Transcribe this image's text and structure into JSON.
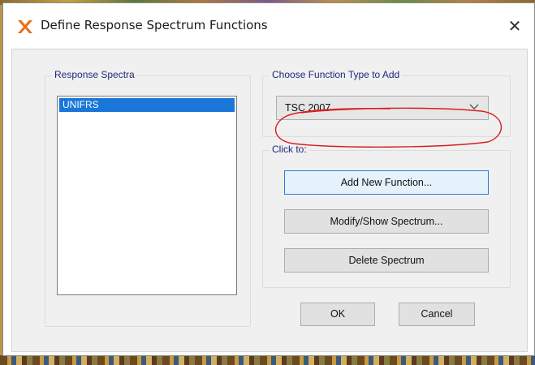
{
  "window": {
    "title": "Define Response Spectrum Functions",
    "icon": "app-logo-icon",
    "close_label": "✕"
  },
  "spectra": {
    "legend": "Response Spectra",
    "items": [
      "UNIFRS"
    ],
    "selected_index": 0
  },
  "function_type": {
    "legend": "Choose  Function Type to Add",
    "selected": "TSC 2007"
  },
  "actions": {
    "legend": "Click to:",
    "add_label": "Add New Function...",
    "modify_label": "Modify/Show Spectrum...",
    "delete_label": "Delete Spectrum"
  },
  "footer": {
    "ok_label": "OK",
    "cancel_label": "Cancel"
  },
  "colors": {
    "selection": "#1a76d8",
    "group_label": "#1e2a7a",
    "annotation": "#d81e1e",
    "app_icon": "#e8691e"
  }
}
